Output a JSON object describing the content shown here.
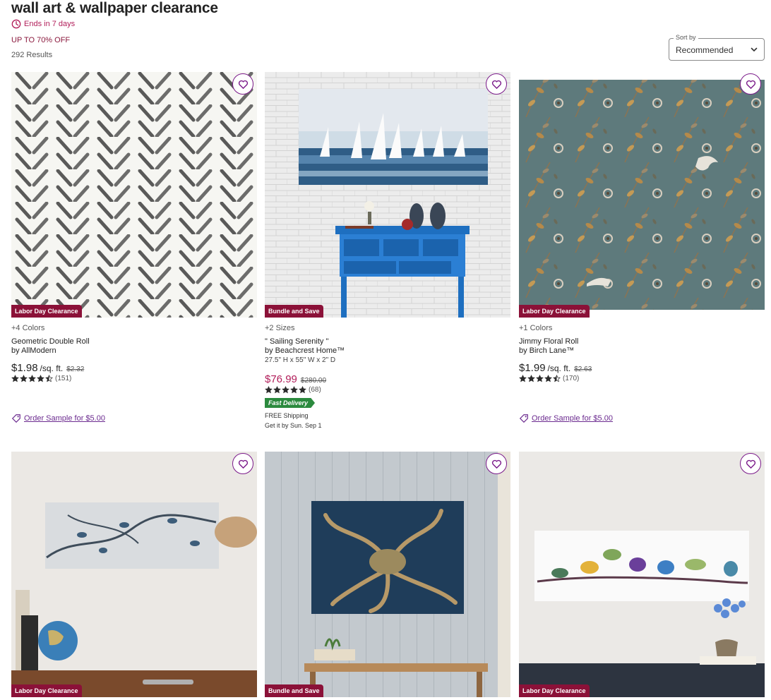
{
  "header": {
    "title": "wall art & wallpaper clearance",
    "ends": "Ends in 7 days",
    "promo": "UP TO 70% OFF",
    "results": "292 Results"
  },
  "sort": {
    "legend": "Sort by",
    "value": "Recommended"
  },
  "colors": {
    "accent": "#b21e5a",
    "badge": "#8b1138",
    "link": "#6b2a8f",
    "fast": "#2b8a3e"
  },
  "products": [
    {
      "badge": "Labor Day Clearance",
      "options": "+4 Colors",
      "name": "Geometric Double Roll",
      "brand": "by AllModern",
      "price": "$1.98",
      "unit": "/sq. ft.",
      "was": "$2.32",
      "rating": 4.5,
      "reviews": "(151)",
      "sample": "Order Sample for $5.00"
    },
    {
      "badge": "Bundle and Save",
      "options": "+2 Sizes",
      "name": "\" Sailing Serenity \"",
      "brand": "by Beachcrest Home™",
      "dims": "27.5\" H x 55\" W x 2\" D",
      "price": "$76.99",
      "was": "$280.00",
      "rating": 5,
      "reviews": "(68)",
      "fast": "Fast Delivery",
      "shipping": "FREE Shipping",
      "delivery": "Get it by Sun. Sep 1"
    },
    {
      "badge": "Labor Day Clearance",
      "options": "+1 Colors",
      "name": "Jimmy Floral Roll",
      "brand": "by Birch Lane™",
      "price": "$1.99",
      "unit": "/sq. ft.",
      "was": "$2.63",
      "rating": 4.5,
      "reviews": "(170)",
      "sample": "Order Sample for $5.00"
    },
    {
      "badge": "Labor Day Clearance"
    },
    {
      "badge": "Bundle and Save"
    },
    {
      "badge": "Labor Day Clearance"
    }
  ]
}
